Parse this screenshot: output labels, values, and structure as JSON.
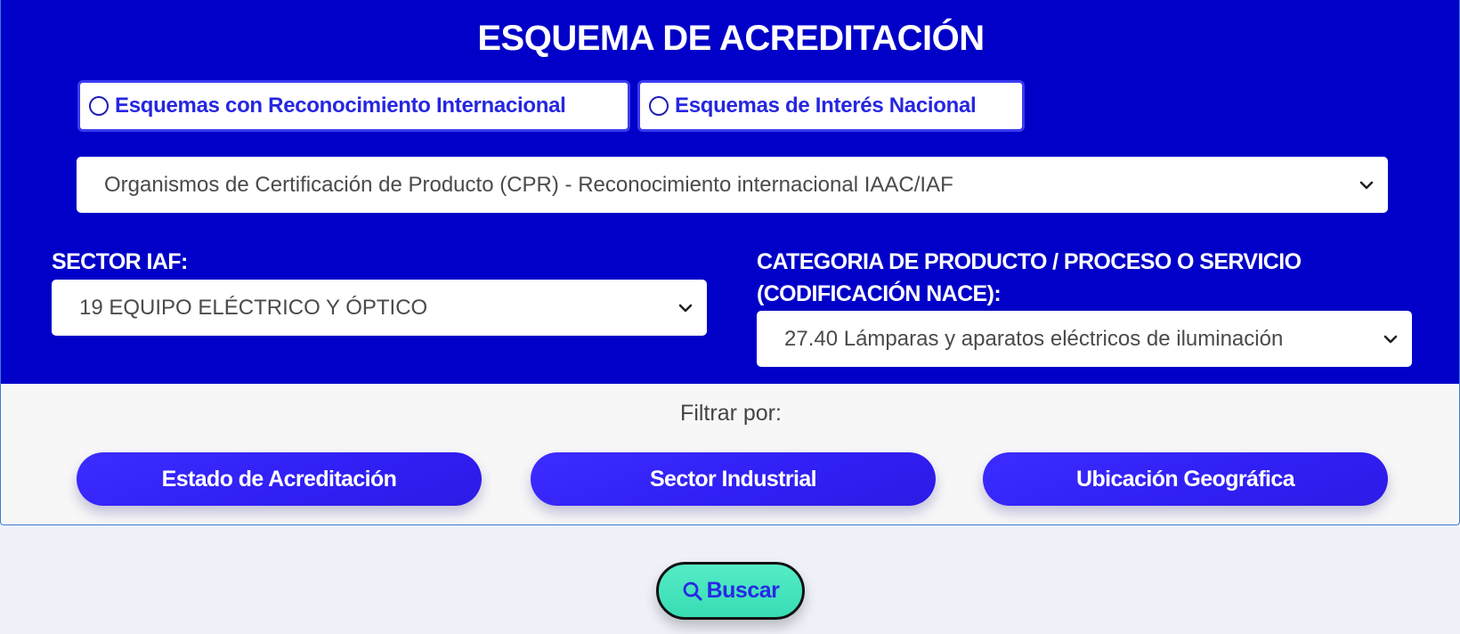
{
  "header": {
    "title": "ESQUEMA DE ACREDITACIÓN"
  },
  "scheme_options": {
    "international": "Esquemas con Reconocimiento Internacional",
    "national": "Esquemas de Interés Nacional"
  },
  "scheme_select": {
    "value": "Organismos de Certificación de Producto (CPR) - Reconocimiento internacional IAAC/IAF"
  },
  "sector": {
    "label": "SECTOR IAF:",
    "value": "19 EQUIPO ELÉCTRICO Y ÓPTICO"
  },
  "category": {
    "label_line1": "CATEGORIA DE PRODUCTO / PROCESO O SERVICIO",
    "label_line2": "(CODIFICACIÓN NACE):",
    "value": "27.40 Lámparas y aparatos eléctricos de iluminación"
  },
  "filters": {
    "label": "Filtrar por:",
    "buttons": [
      "Estado de Acreditación",
      "Sector Industrial",
      "Ubicación Geográfica"
    ]
  },
  "search": {
    "label": "Buscar",
    "icon": "search-icon"
  },
  "colors": {
    "panel": "#0000c8",
    "accent": "#3120f5",
    "search_button": "#45e3bc"
  }
}
